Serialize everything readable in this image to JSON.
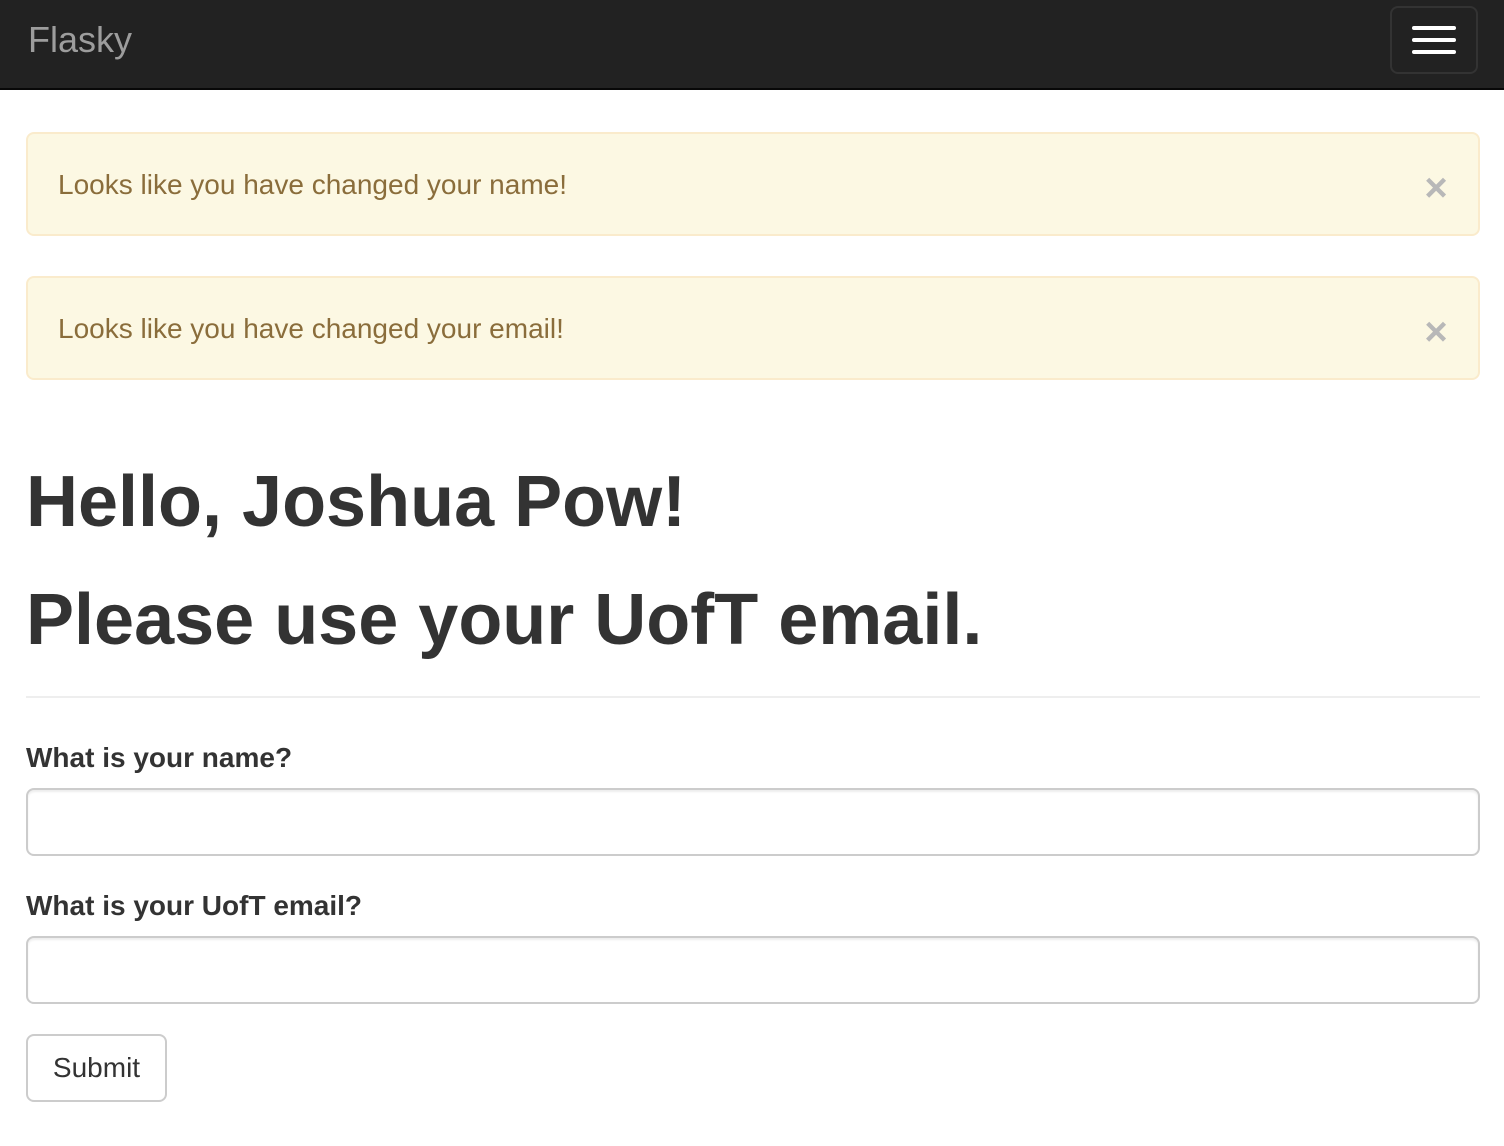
{
  "navbar": {
    "brand": "Flasky",
    "toggle_icon": "hamburger-menu-icon",
    "background": "#222222"
  },
  "alerts": [
    {
      "message": "Looks like you have changed your name!",
      "close": "×"
    },
    {
      "message": "Looks like you have changed your email!",
      "close": "×"
    }
  ],
  "alert_colors": {
    "background": "#fcf8e3",
    "border": "#faebcc",
    "text": "#8a6d3b"
  },
  "page_header": {
    "greeting": "Hello, Joshua Pow!",
    "instruction": "Please use your UofT email."
  },
  "form": {
    "name_label": "What is your name?",
    "name_value": "",
    "email_label": "What is your UofT email?",
    "email_value": "",
    "submit_label": "Submit"
  }
}
